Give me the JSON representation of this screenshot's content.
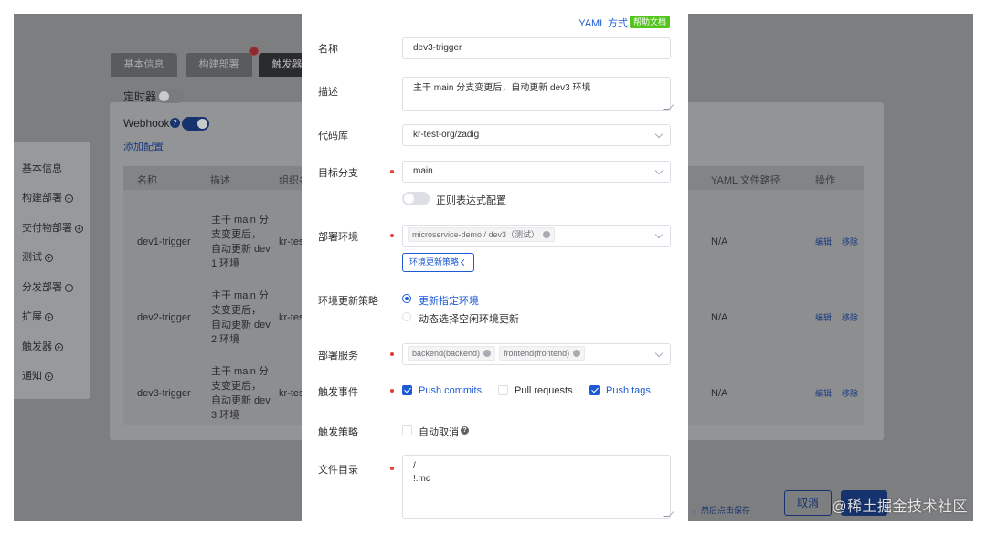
{
  "background": {
    "tabs": [
      "基本信息",
      "构建部署",
      "触发器"
    ],
    "timer_label": "定时器",
    "webhook_label": "Webhook",
    "add_config_link": "添加配置",
    "side_nav": [
      {
        "label": "基本信息",
        "has_plus": false
      },
      {
        "label": "构建部署",
        "has_plus": true
      },
      {
        "label": "交付物部署",
        "has_plus": true
      },
      {
        "label": "测试",
        "has_plus": true
      },
      {
        "label": "分发部署",
        "has_plus": true
      },
      {
        "label": "扩展",
        "has_plus": true
      },
      {
        "label": "触发器",
        "has_plus": true
      },
      {
        "label": "通知",
        "has_plus": true
      }
    ],
    "table": {
      "headers": [
        "名称",
        "描述",
        "组织名",
        "YAML 文件路径",
        "操作"
      ],
      "rows": [
        {
          "name": "dev1-trigger",
          "desc": [
            "主干 main 分",
            "支变更后，",
            "自动更新 dev",
            "1 环境"
          ],
          "org": "kr-tes",
          "yaml": "N/A",
          "edit": "编辑",
          "remove": "移除"
        },
        {
          "name": "dev2-trigger",
          "desc": [
            "主干 main 分",
            "支变更后，",
            "自动更新 dev",
            "2 环境"
          ],
          "org": "kr-tes",
          "yaml": "N/A",
          "edit": "编辑",
          "remove": "移除"
        },
        {
          "name": "dev3-trigger",
          "desc": [
            "主干 main 分",
            "支变更后，",
            "自动更新 dev",
            "3 环境"
          ],
          "org": "kr-tes",
          "yaml": "N/A",
          "edit": "编辑",
          "remove": "移除"
        }
      ]
    },
    "cancel_button": "取消",
    "hint_text": "，然后点击保存",
    "watermark": "@稀土掘金技术社区"
  },
  "drawer": {
    "yaml_link": "YAML 方式",
    "help_badge": "帮助文档",
    "fields": {
      "name": {
        "label": "名称",
        "value": "dev3-trigger"
      },
      "desc": {
        "label": "描述",
        "value": "主干 main 分支变更后，自动更新 dev3 环境"
      },
      "repo": {
        "label": "代码库",
        "value": "kr-test-org/zadig"
      },
      "branch": {
        "label": "目标分支",
        "value": "main",
        "regex_toggle_label": "正则表达式配置"
      },
      "env": {
        "label": "部署环境",
        "tag": "microservice-demo / dev3（测试）",
        "strategy_button": "环境更新策略"
      },
      "env_strategy": {
        "label": "环境更新策略",
        "options": [
          "更新指定环境",
          "动态选择空闲环境更新"
        ],
        "selected": 0
      },
      "services": {
        "label": "部署服务",
        "tags": [
          "backend(backend)",
          "frontend(frontend)"
        ]
      },
      "events": {
        "label": "触发事件",
        "options": [
          {
            "label": "Push commits",
            "checked": true
          },
          {
            "label": "Pull requests",
            "checked": false
          },
          {
            "label": "Push tags",
            "checked": true
          }
        ]
      },
      "policy": {
        "label": "触发策略",
        "option": "自动取消",
        "checked": false
      },
      "file_dir": {
        "label": "文件目录",
        "lines": [
          "/",
          "!.md"
        ]
      }
    }
  },
  "colors": {
    "accent": "#1d5bd6",
    "required": "#e53935",
    "badge": "#52c41a",
    "overlay": "#7d7e80"
  }
}
